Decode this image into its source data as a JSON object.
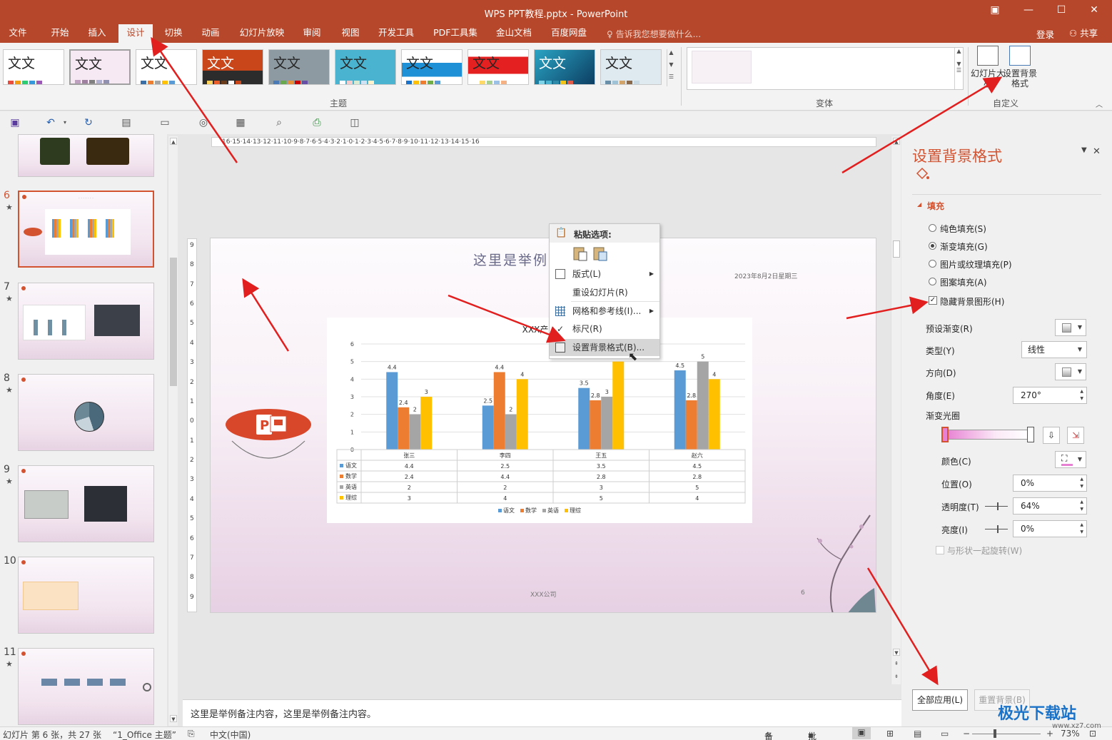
{
  "window": {
    "title": "WPS PPT教程.pptx - PowerPoint"
  },
  "tabs": [
    "文件",
    "开始",
    "插入",
    "设计",
    "切换",
    "动画",
    "幻灯片放映",
    "审阅",
    "视图",
    "开发工具",
    "PDF工具集",
    "金山文档",
    "百度网盘"
  ],
  "active_tab": "设计",
  "tell_me": "告诉我您想要做什么...",
  "login": "登录",
  "share": "共享",
  "ribbon": {
    "theme_sample": "文文",
    "themes_label": "主题",
    "variants_label": "变体",
    "custom_label": "自定义",
    "slide_size_label": "幻灯片大小",
    "format_bg_label": "设置背景格式"
  },
  "theme_colors": [
    "#ffffff",
    "#f6e9f3",
    "#ffffff",
    "#c8461a",
    "#8e9aa1",
    "#4ab3cf",
    "#ffffff",
    "#ffffff",
    "#1b4f7a",
    "#dfeaf0"
  ],
  "ruler": {
    "h_ticks": "16·15·14·13·12·11·10·9·8·7·6·5·4·3·2·1·0·1·2·3·4·5·6·7·8·9·10·11·12·13·14·15·16",
    "v_ticks": [
      "9",
      "8",
      "7",
      "6",
      "5",
      "4",
      "3",
      "2",
      "1",
      "0",
      "1",
      "2",
      "3",
      "4",
      "5",
      "6",
      "7",
      "8",
      "9"
    ]
  },
  "thumbnails": [
    {
      "num": "6",
      "star": "★",
      "selected": true
    },
    {
      "num": "7",
      "star": "★"
    },
    {
      "num": "8",
      "star": "★"
    },
    {
      "num": "9",
      "star": "★"
    },
    {
      "num": "10",
      "star": ""
    },
    {
      "num": "11",
      "star": "★"
    }
  ],
  "slide": {
    "title": "这里是举例",
    "date": "2023年8月2日星期三",
    "company": "XXX公司",
    "page": "6"
  },
  "chart_data": {
    "type": "bar",
    "title": "XXX产品",
    "categories": [
      "张三",
      "李四",
      "王五",
      "赵六"
    ],
    "series": [
      {
        "name": "语文",
        "color": "#5b9bd5",
        "values": [
          4.4,
          2.5,
          3.5,
          4.5
        ]
      },
      {
        "name": "数学",
        "color": "#ed7d31",
        "values": [
          2.4,
          4.4,
          2.8,
          2.8
        ]
      },
      {
        "name": "英语",
        "color": "#a5a5a5",
        "values": [
          2,
          2,
          3,
          5
        ]
      },
      {
        "name": "理综",
        "color": "#ffc000",
        "values": [
          3,
          4,
          5,
          4
        ]
      }
    ],
    "ylim": [
      0,
      6
    ],
    "yticks": [
      "0",
      "1",
      "2",
      "3",
      "4",
      "5",
      "6"
    ],
    "grid": true,
    "legend": "bottom",
    "data_table": true
  },
  "context_menu": {
    "paste_header": "粘贴选项:",
    "items": [
      {
        "label": "版式(L)",
        "submenu": true
      },
      {
        "label": "重设幻灯片(R)",
        "submenu": false
      },
      {
        "label": "网格和参考线(I)...",
        "submenu": true
      },
      {
        "label": "标尺(R)",
        "submenu": false,
        "checked": true
      },
      {
        "label": "设置背景格式(B)...",
        "submenu": false,
        "highlighted": true
      }
    ]
  },
  "format_panel": {
    "title": "设置背景格式",
    "section": "填充",
    "fill_options": [
      {
        "label": "纯色填充(S)",
        "selected": false
      },
      {
        "label": "渐变填充(G)",
        "selected": true
      },
      {
        "label": "图片或纹理填充(P)",
        "selected": false
      },
      {
        "label": "图案填充(A)",
        "selected": false
      }
    ],
    "hide_bg_graphics": "隐藏背景图形(H)",
    "preset_gradient": "预设渐变(R)",
    "type_label": "类型(Y)",
    "type_value": "线性",
    "direction_label": "方向(D)",
    "angle_label": "角度(E)",
    "angle_value": "270°",
    "stops_label": "渐变光圈",
    "color_label": "颜色(C)",
    "position_label": "位置(O)",
    "position_value": "0%",
    "transparency_label": "透明度(T)",
    "transparency_value": "64%",
    "brightness_label": "亮度(I)",
    "brightness_value": "0%",
    "rotate_with_shape": "与形状一起旋转(W)",
    "apply_all": "全部应用(L)",
    "reset_bg": "重置背景(B)"
  },
  "notes": "这里是举例备注内容，这里是举例备注内容。",
  "status": {
    "slide_info": "幻灯片 第 6 张，共 27 张",
    "theme": "“1_Office 主题”",
    "language": "中文(中国)",
    "notes_btn": "备注",
    "comments_btn": "批注",
    "zoom": "73%"
  },
  "watermark": {
    "text": "极光下载站",
    "sub": "www.xz7.com"
  }
}
